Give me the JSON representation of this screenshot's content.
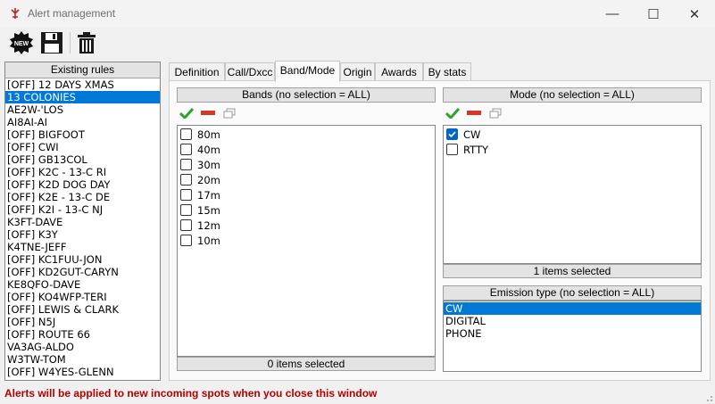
{
  "window": {
    "title": "Alert management",
    "controls": {
      "minimize": "—",
      "maximize": "☐",
      "close": "✕"
    }
  },
  "toolbar": {
    "new_badge": "NEW",
    "icons": [
      "new-icon",
      "save-icon",
      "trash-icon"
    ]
  },
  "rules": {
    "header": "Existing rules",
    "selected_index": 1,
    "items": [
      "[OFF] 12 DAYS XMAS",
      "13 COLONIES",
      "AE2W-'LOS",
      "AI8AI-AI",
      "[OFF] BIGFOOT",
      "[OFF] CWI",
      "[OFF] GB13COL",
      "[OFF] K2C - 13-C RI",
      "[OFF] K2D DOG DAY",
      "[OFF] K2E - 13-C DE",
      "[OFF] K2I - 13-C NJ",
      "K3FT-DAVE",
      "[OFF] K3Y",
      "K4TNE-JEFF",
      "[OFF] KC1FUU-JON",
      "[OFF] KD2GUT-CARYN",
      "KE8QFO-DAVE",
      "[OFF] KO4WFP-TERI",
      "[OFF] LEWIS & CLARK",
      "[OFF] N5J",
      "[OFF] ROUTE 66",
      "VA3AG-ALDO",
      "W3TW-TOM",
      "[OFF] W4YES-GLENN"
    ]
  },
  "tabs": [
    {
      "label": "Definition",
      "active": false
    },
    {
      "label": "Call/Dxcc",
      "active": false
    },
    {
      "label": "Band/Mode",
      "active": true
    },
    {
      "label": "Origin",
      "active": false
    },
    {
      "label": "Awards",
      "active": false
    },
    {
      "label": "By stats",
      "active": false
    }
  ],
  "bands": {
    "header": "Bands (no selection = ALL)",
    "items": [
      {
        "label": "80m",
        "checked": false
      },
      {
        "label": "40m",
        "checked": false
      },
      {
        "label": "30m",
        "checked": false
      },
      {
        "label": "20m",
        "checked": false
      },
      {
        "label": "17m",
        "checked": false
      },
      {
        "label": "15m",
        "checked": false
      },
      {
        "label": "12m",
        "checked": false
      },
      {
        "label": "10m",
        "checked": false
      }
    ],
    "status": "0 items selected"
  },
  "mode": {
    "header": "Mode (no selection = ALL)",
    "items": [
      {
        "label": "CW",
        "checked": true
      },
      {
        "label": "RTTY",
        "checked": false
      }
    ],
    "status": "1 items selected"
  },
  "emission": {
    "header": "Emission type (no selection = ALL)",
    "selected_index": 0,
    "items": [
      "CW",
      "DIGITAL",
      "PHONE"
    ]
  },
  "status_message": "Alerts will be applied to new incoming spots when you close this window",
  "colors": {
    "selection": "#0078d7",
    "status_text": "#b20000",
    "check_green": "#2fa12f",
    "remove_red": "#d9342b"
  }
}
